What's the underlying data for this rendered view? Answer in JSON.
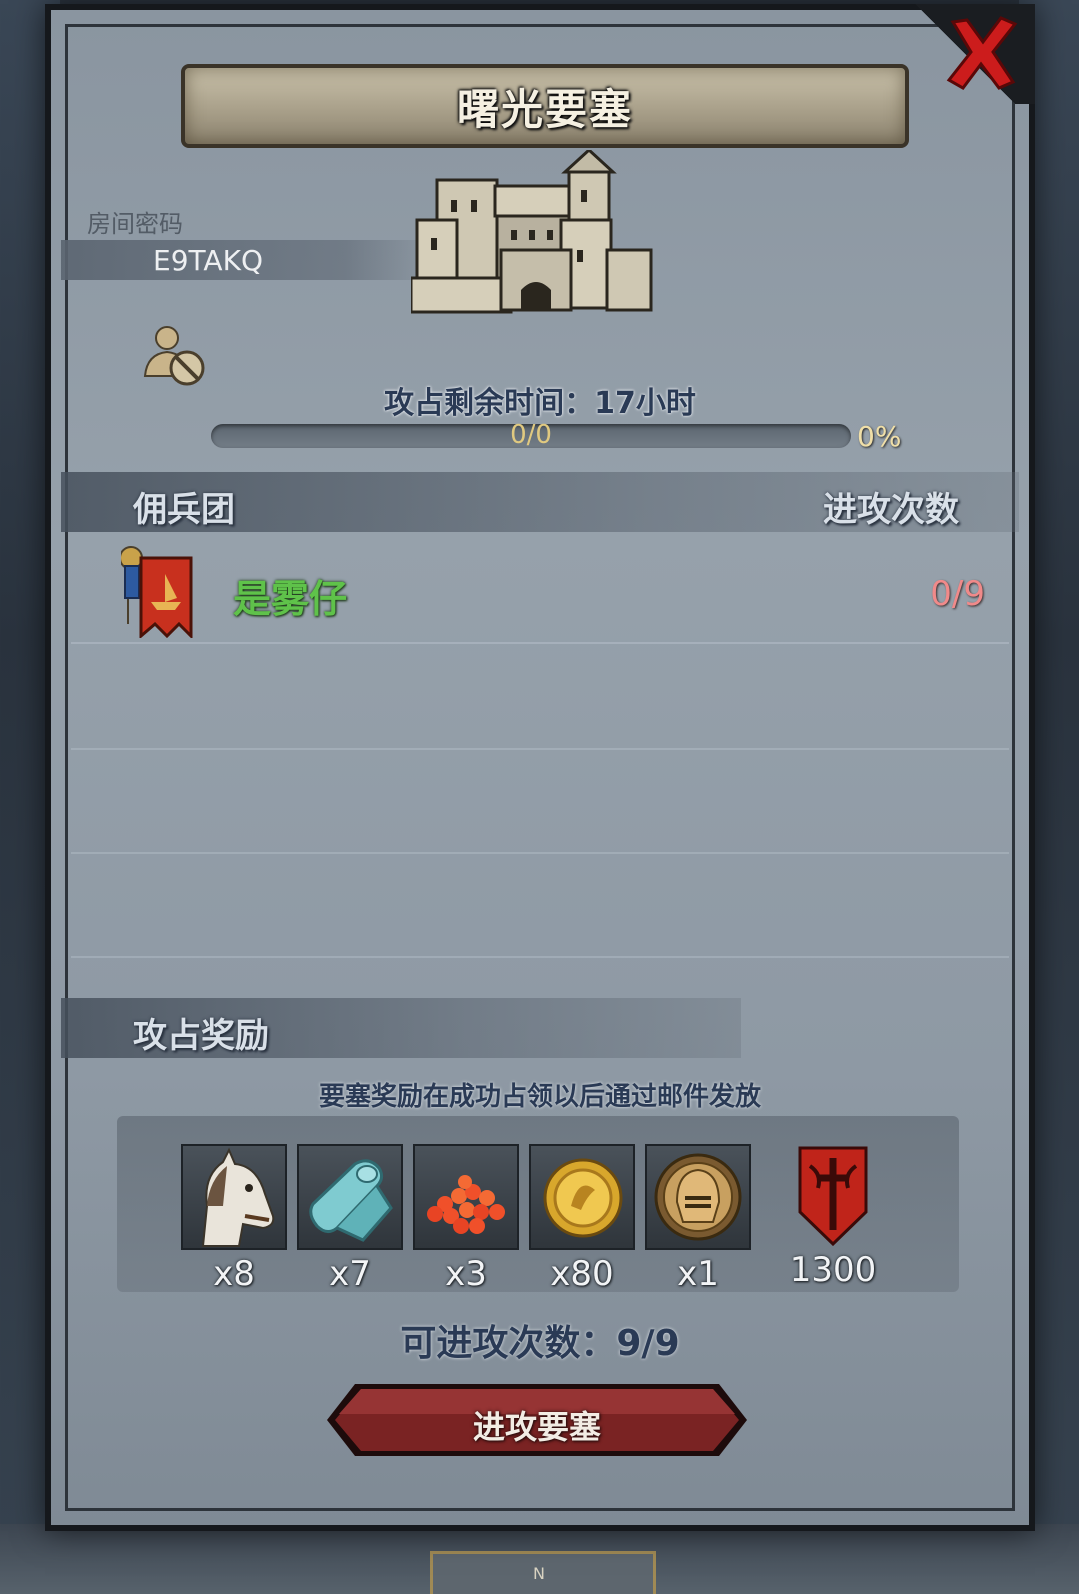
{
  "dialog": {
    "title": "曙光要塞",
    "room_password_label": "房间密码",
    "room_password": "E9TAKQ",
    "timer": "攻占剩余时间：17小时",
    "progress": {
      "text": "0/0",
      "percent_text": "0%",
      "fraction": 0
    },
    "mercenary_section": {
      "title": "佣兵团",
      "attack_count_header": "进攻次数",
      "rows": [
        {
          "name": "是雾仔",
          "count": "0/9"
        }
      ]
    },
    "reward_section": {
      "title": "攻占奖励",
      "note": "要塞奖励在成功占领以后通过邮件发放",
      "items": [
        {
          "icon": "horse-icon",
          "qty": "x8"
        },
        {
          "icon": "cloth-icon",
          "qty": "x7"
        },
        {
          "icon": "red-beads-icon",
          "qty": "x3"
        },
        {
          "icon": "gold-coin-icon",
          "qty": "x80"
        },
        {
          "icon": "knight-helmet-icon",
          "qty": "x1"
        },
        {
          "icon": "red-shield-icon",
          "qty": "1300"
        }
      ]
    },
    "attempts": "可进攻次数：9/9",
    "attack_button": "进攻要塞",
    "bottom_tab": "N"
  },
  "colors": {
    "merc_name": "#5fc24a",
    "merc_count": "#f08a8a",
    "button": "#7a2323",
    "close": "#cc1c1c"
  }
}
